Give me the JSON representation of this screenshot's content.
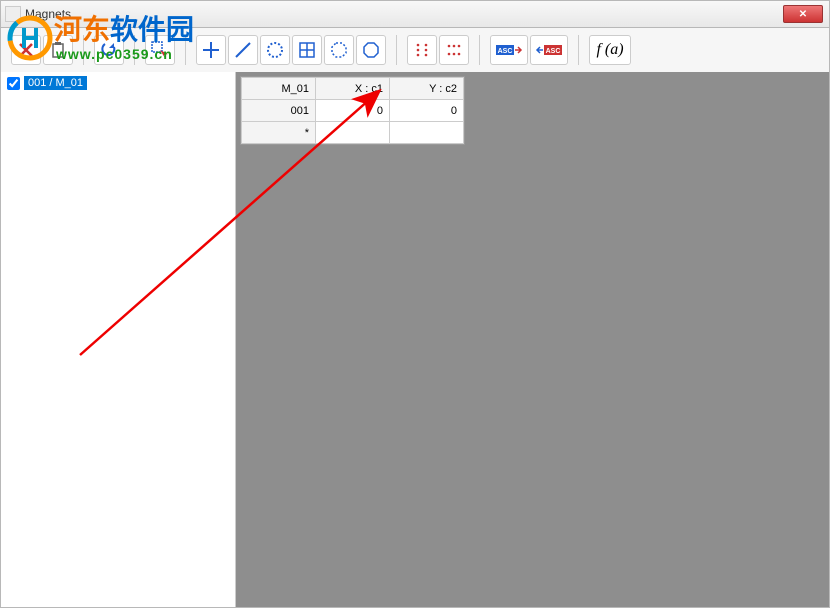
{
  "window": {
    "title": "Magnets",
    "close": "✕"
  },
  "watermark": {
    "brand_cn_1": "河东",
    "brand_cn_2": "软件园",
    "url": "www.pc0359.cn"
  },
  "toolbar": {
    "icons": [
      "delete-x",
      "paste",
      "refresh",
      "select-rect",
      "crosshair",
      "line",
      "circle",
      "grid4",
      "octagon-dashed",
      "octagon",
      "dots-v",
      "dots-h",
      "asc-export",
      "asc-import",
      "fx"
    ]
  },
  "sidebar": {
    "items": [
      {
        "checked": true,
        "label": "001 / M_01"
      }
    ]
  },
  "grid": {
    "headers": [
      "M_01",
      "X : c1",
      "Y : c2"
    ],
    "rows": [
      {
        "h": "001",
        "x": "0",
        "y": "0"
      },
      {
        "h": "*",
        "x": "",
        "y": ""
      }
    ]
  }
}
